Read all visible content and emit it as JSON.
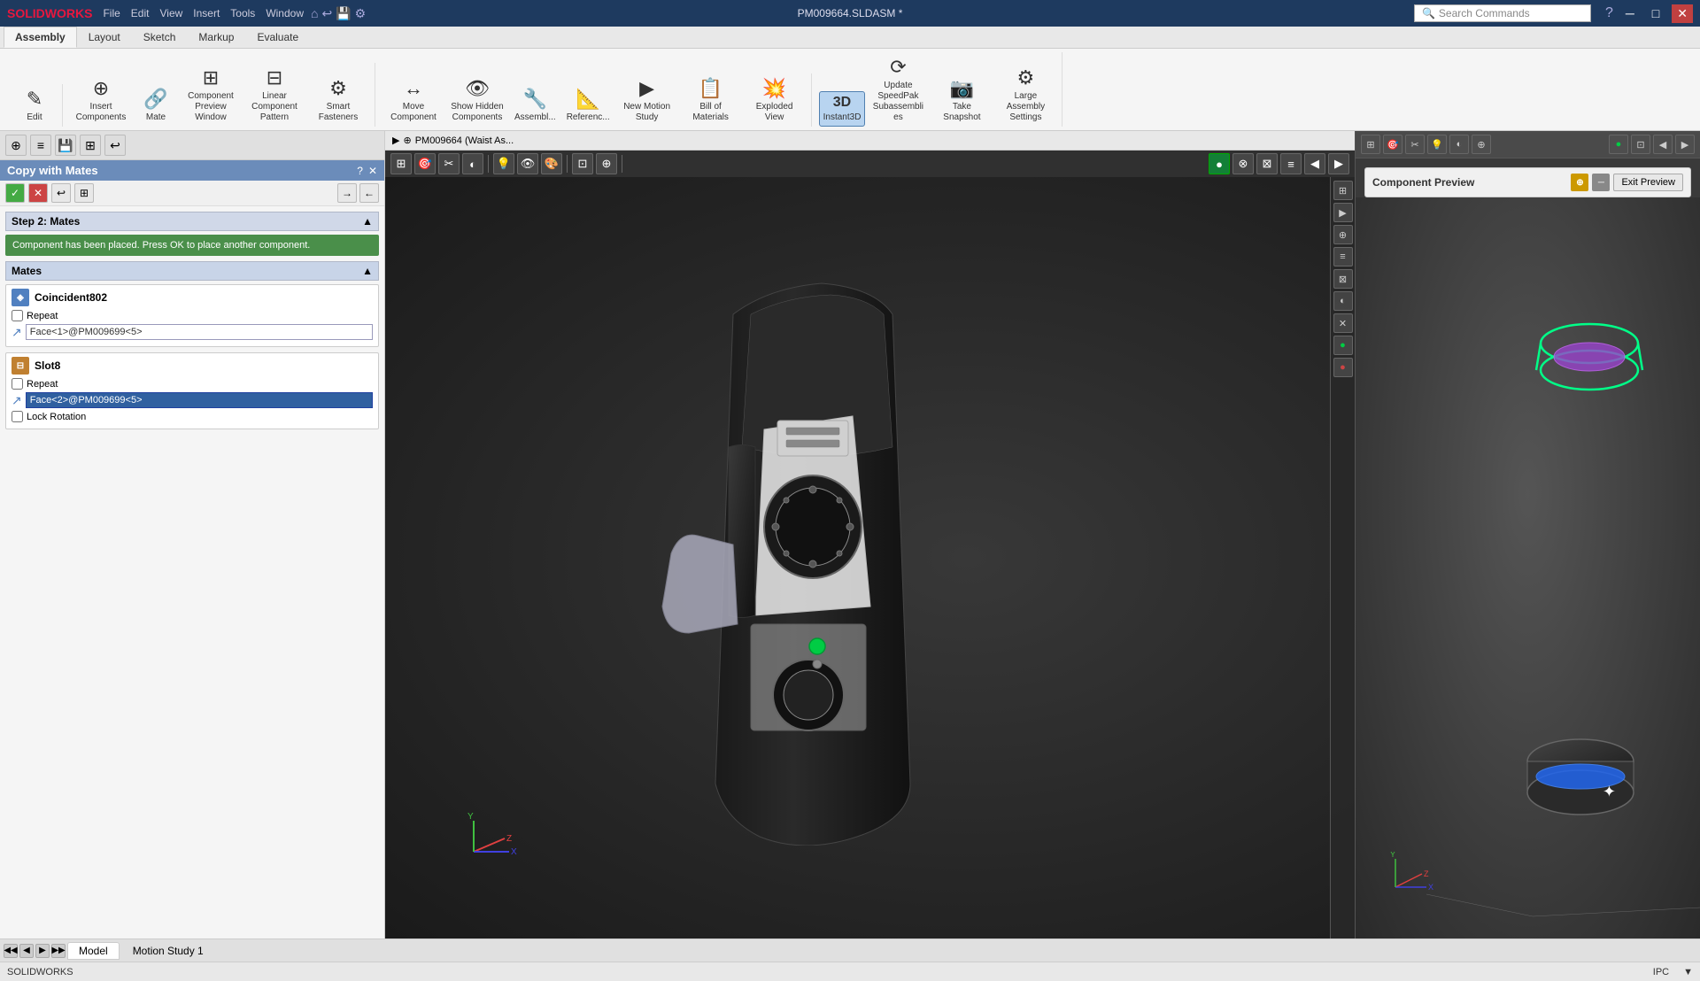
{
  "titlebar": {
    "logo": "SOLIDWORKS",
    "menus": [
      "File",
      "Edit",
      "View",
      "Insert",
      "Tools",
      "Window"
    ],
    "title": "PM009664.SLDASM *",
    "search_placeholder": "Search Commands",
    "window_controls": [
      "─",
      "□",
      "✕"
    ]
  },
  "ribbon": {
    "tabs": [
      "Assembly",
      "Layout",
      "Sketch",
      "Markup",
      "Evaluate"
    ],
    "active_tab": "Assembly",
    "buttons": [
      {
        "id": "edit",
        "label": "Edit",
        "icon": "✎"
      },
      {
        "id": "insert-components",
        "label": "Insert Components",
        "icon": "⊕"
      },
      {
        "id": "mate",
        "label": "Mate",
        "icon": "🔗"
      },
      {
        "id": "component-preview",
        "label": "Component Preview Window",
        "icon": "⊞"
      },
      {
        "id": "linear-pattern",
        "label": "Linear Component Pattern",
        "icon": "⊟"
      },
      {
        "id": "smart-fasteners",
        "label": "Smart Fasteners",
        "icon": "⚙"
      },
      {
        "id": "move-component",
        "label": "Move Component",
        "icon": "↔"
      },
      {
        "id": "show-hidden",
        "label": "Show Hidden Components",
        "icon": "👁"
      },
      {
        "id": "assembly",
        "label": "Assembl...",
        "icon": "🔧"
      },
      {
        "id": "reference",
        "label": "Referenc...",
        "icon": "📐"
      },
      {
        "id": "new-motion",
        "label": "New Motion Study",
        "icon": "▶"
      },
      {
        "id": "bill-materials",
        "label": "Bill of Materials",
        "icon": "📋"
      },
      {
        "id": "exploded-view",
        "label": "Exploded View",
        "icon": "💥"
      },
      {
        "id": "instant3d",
        "label": "Instant3D",
        "icon": "3D"
      },
      {
        "id": "update-speedpak",
        "label": "Update SpeedPak Subassemblies",
        "icon": "⟳"
      },
      {
        "id": "take-snapshot",
        "label": "Take Snapshot",
        "icon": "📷"
      },
      {
        "id": "large-assembly",
        "label": "Large Assembly Settings",
        "icon": "⚙"
      }
    ]
  },
  "left_panel": {
    "header_icons": [
      "⊕",
      "≡",
      "💾",
      "⊞",
      "↩"
    ],
    "title": "Copy with Mates",
    "title_icons": [
      "?",
      "✕"
    ],
    "toolbar": [
      "✓",
      "✕",
      "↩",
      "⊞",
      "→"
    ],
    "step_label": "Step 2: Mates",
    "success_message": "Component has been placed. Press OK to place another component.",
    "mates_label": "Mates",
    "mate_items": [
      {
        "id": "coincident802",
        "name": "Coincident802",
        "icon": "◈",
        "icon_color": "blue",
        "repeat": false,
        "face_value": "Face<1>@PM009699<5>"
      },
      {
        "id": "slot8",
        "name": "Slot8",
        "icon": "⊟",
        "icon_color": "orange",
        "repeat": false,
        "face_value": "Face<2>@PM009699<5>",
        "selected": true,
        "lock_rotation": false
      }
    ]
  },
  "viewport": {
    "breadcrumb": "PM009664 (Waist As...",
    "breadcrumb_icon": "⊕"
  },
  "component_preview": {
    "title": "Component Preview",
    "exit_button": "Exit Preview"
  },
  "bottom_tabs": {
    "nav_buttons": [
      "◀◀",
      "◀",
      "▶",
      "▶▶"
    ],
    "tabs": [
      "Model",
      "Motion Study 1"
    ],
    "active_tab": "Model"
  },
  "status_bar": {
    "left": "SOLIDWORKS",
    "right": [
      "IPC",
      "▼"
    ]
  }
}
